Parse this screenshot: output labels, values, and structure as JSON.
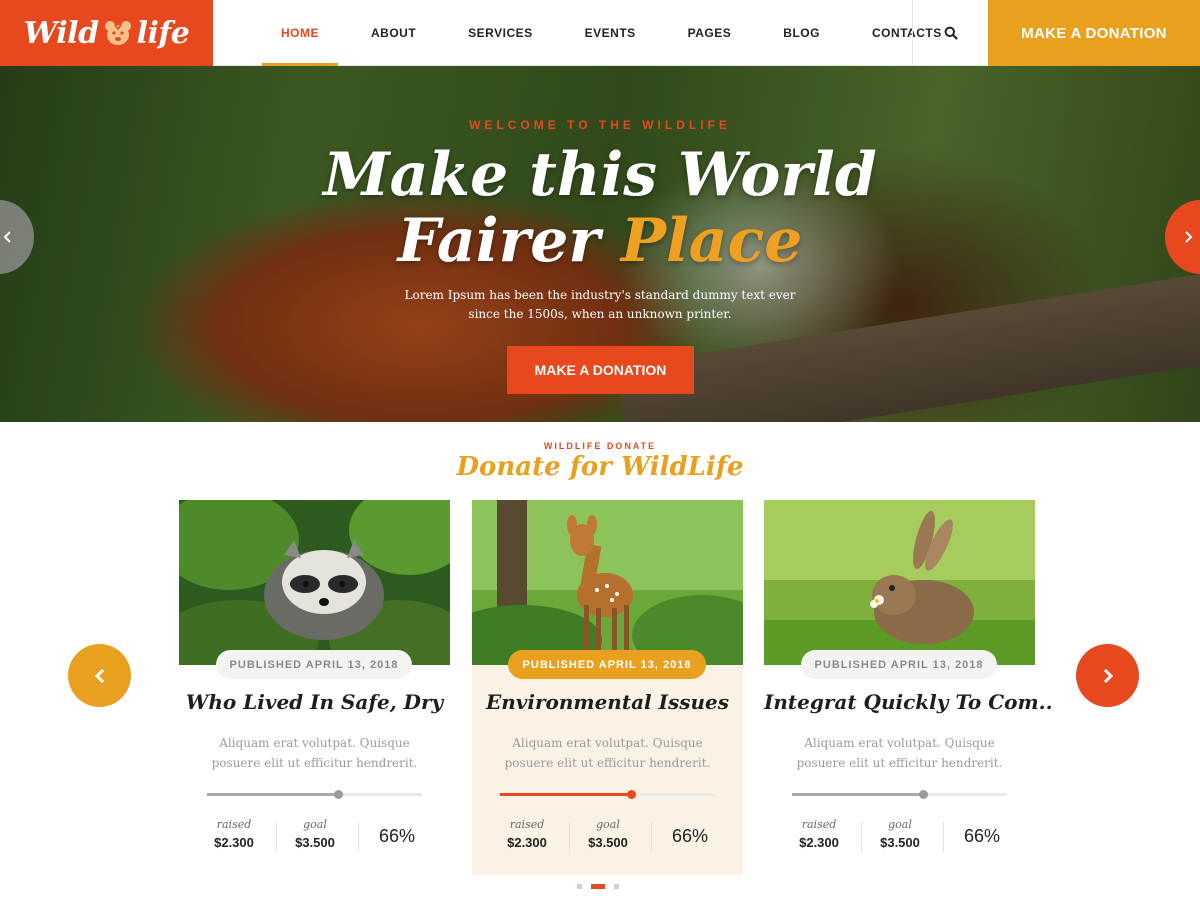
{
  "brand": {
    "logo_text_left": "Wild",
    "logo_text_right": "life"
  },
  "nav": {
    "items": [
      {
        "label": "HOME",
        "active": true
      },
      {
        "label": "ABOUT"
      },
      {
        "label": "SERVICES"
      },
      {
        "label": "EVENTS"
      },
      {
        "label": "PAGES"
      },
      {
        "label": "BLOG"
      },
      {
        "label": "CONTACTS"
      }
    ],
    "search_icon": "search-icon",
    "donate_label": "MAKE A DONATION"
  },
  "hero": {
    "subtitle": "WELCOME TO THE WILDLIFE",
    "title_line1": "Make this World",
    "title_line2_a": "Fairer",
    "title_line2_b": "Place",
    "description": "Lorem Ipsum has been the industry's standard dummy text ever since the 1500s, when an unknown printer.",
    "button_label": "MAKE A DONATION",
    "prev_icon": "chevron-left-icon",
    "next_icon": "chevron-right-icon"
  },
  "donate": {
    "subtitle": "WILDLIFE DONATE",
    "title": "Donate for WildLife",
    "cards": [
      {
        "published": "PUBLISHED APRIL 13, 2018",
        "title": "Who Lived In Safe, Dry",
        "description": "Aliquam erat volutpat. Quisque posuere elit ut efficitur hendrerit.",
        "raised_label": "raised",
        "raised": "$2.300",
        "goal_label": "goal",
        "goal": "$3.500",
        "percent": "66%",
        "progress": 0.61
      },
      {
        "published": "PUBLISHED APRIL 13, 2018",
        "title": "Environmental Issues",
        "description": "Aliquam erat volutpat. Quisque posuere elit ut efficitur hendrerit.",
        "raised_label": "raised",
        "raised": "$2.300",
        "goal_label": "goal",
        "goal": "$3.500",
        "percent": "66%",
        "progress": 0.61
      },
      {
        "published": "PUBLISHED APRIL 13, 2018",
        "title": "Integrat Quickly To Com..",
        "description": "Aliquam erat volutpat. Quisque posuere elit ut efficitur hendrerit.",
        "raised_label": "raised",
        "raised": "$2.300",
        "goal_label": "goal",
        "goal": "$3.500",
        "percent": "66%",
        "progress": 0.61
      }
    ],
    "active_card": 1,
    "pagination": {
      "count": 3,
      "active": 1
    }
  },
  "colors": {
    "primary": "#e8481e",
    "accent": "#e9a01f",
    "featured_bg": "#fbf2e6"
  }
}
